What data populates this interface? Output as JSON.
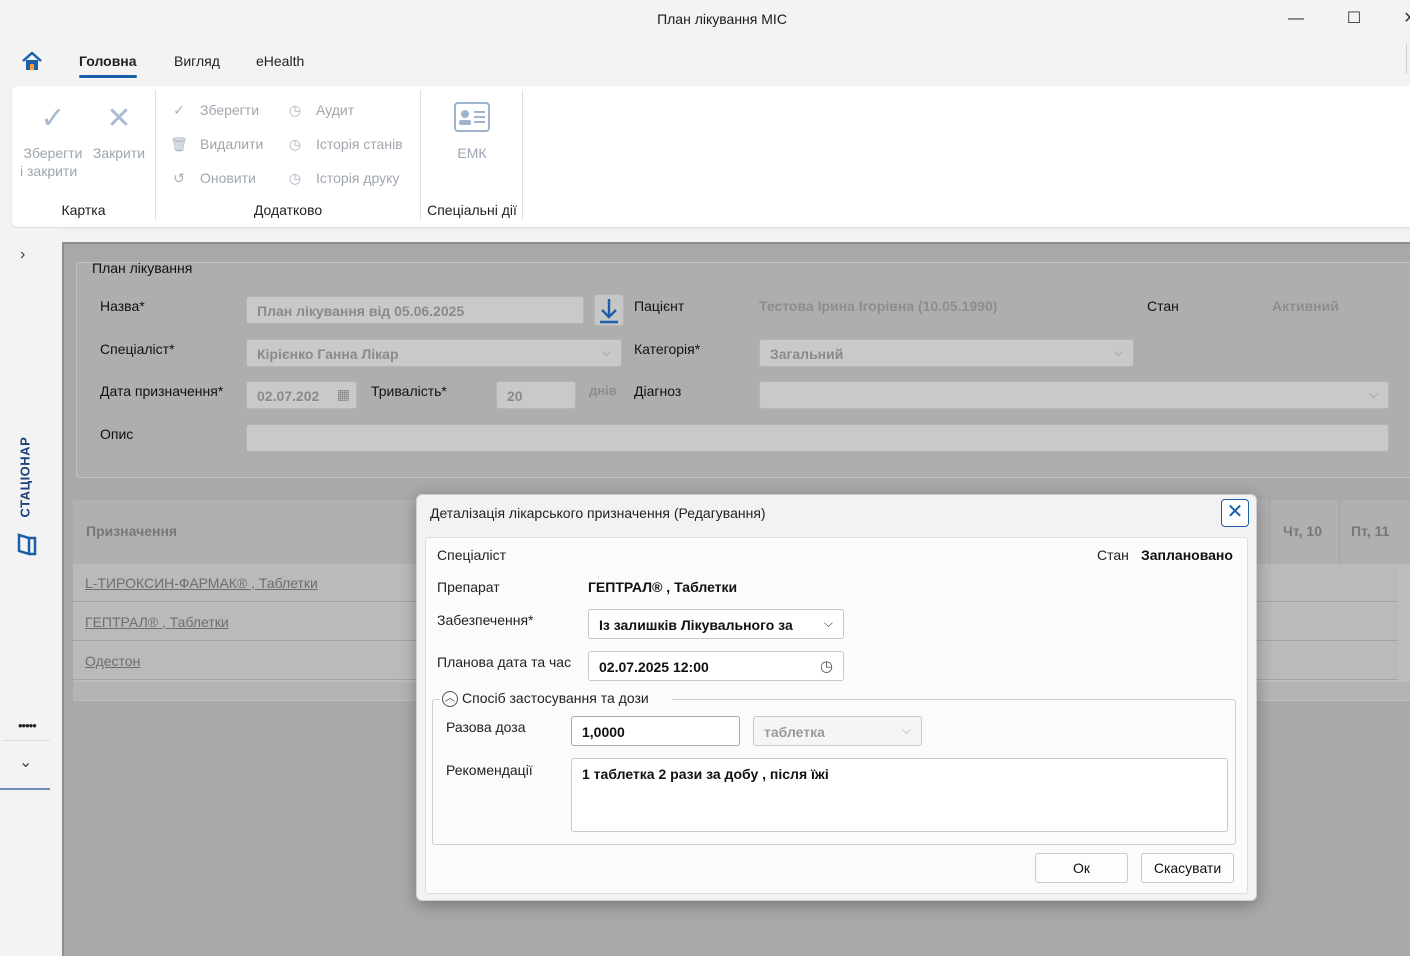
{
  "window": {
    "title": "План лікування МІС"
  },
  "menu": {
    "tabs": [
      {
        "label": "Головна"
      },
      {
        "label": "Вигляд"
      },
      {
        "label": "eHealth"
      }
    ]
  },
  "ribbon": {
    "save_close_line1": "Зберегти",
    "save_close_line2": "і закрити",
    "close": "Закрити",
    "save": "Зберегти",
    "delete": "Видалити",
    "refresh": "Оновити",
    "audit": "Аудит",
    "state_history": "Історія станів",
    "print_history": "Історія друку",
    "emk": "ЕМК",
    "groups": {
      "card": "Картка",
      "extra": "Додатково",
      "special": "Спеціальні дії"
    }
  },
  "sidebar": {
    "label": "СТАЦІОНАР"
  },
  "plan": {
    "group_title": "План лікування",
    "name_label": "Назва*",
    "name_value": "План лікування від 05.06.2025",
    "patient_label": "Пацієнт",
    "patient_value": "Тестова Ірина Ігорівна (10.05.1990)",
    "state_label": "Стан",
    "state_value": "Активний",
    "specialist_label": "Спеціаліст*",
    "specialist_value": "Кірієнко Ганна Лікар",
    "category_label": "Категорія*",
    "category_value": "Загальний",
    "date_label": "Дата призначення*",
    "date_value": "02.07.202",
    "duration_label": "Тривалість*",
    "duration_value": "20",
    "days_label": "днів",
    "diagnosis_label": "Діагноз",
    "description_label": "Опис"
  },
  "table": {
    "header": "Призначення",
    "day_headers": [
      "Чт, 10",
      "Пт, 11"
    ],
    "rows": [
      "L-ТИРОКСИН-ФАРМАК® , Таблетки",
      "ГЕПТРАЛ® , Таблетки",
      "Одестон"
    ]
  },
  "dialog": {
    "title": "Деталізація лікарського призначення (Редагування)",
    "specialist_label": "Спеціаліст",
    "state_label": "Стан",
    "state_value": "Заплановано",
    "drug_label": "Препарат",
    "drug_value": "ГЕПТРАЛ® , Таблетки",
    "supply_label": "Забезпечення*",
    "supply_value": "Із залишків Лікувального за",
    "planned_label": "Планова дата та час",
    "planned_value": "02.07.2025 12:00",
    "section_title": "Спосіб застосування та дози",
    "dose_label": "Разова доза",
    "dose_value": "1,0000",
    "unit_value": "таблетка",
    "recommend_label": "Рекомендації",
    "recommend_value": "1 таблетка 2 рази за добу , після їжі",
    "ok": "Ок",
    "cancel": "Скасувати"
  }
}
